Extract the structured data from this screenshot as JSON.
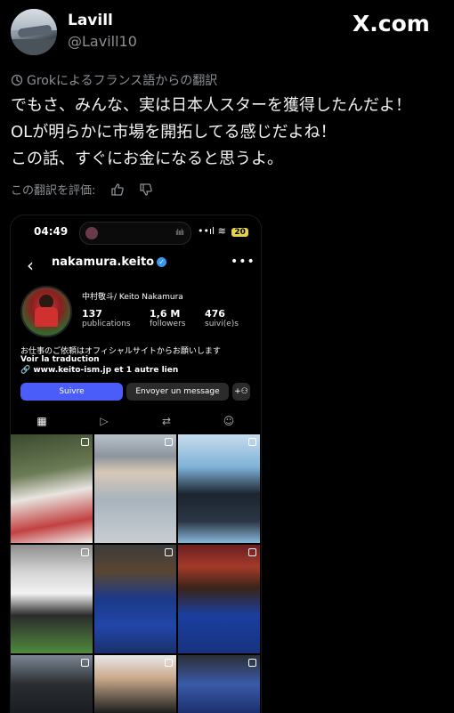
{
  "post": {
    "display_name": "Lavill",
    "handle": "@Lavill10",
    "brand": "X.com",
    "brand_icon": "x-logo",
    "translation_note": "Grokによるフランス語からの翻訳",
    "lines": [
      "でもさ、みんな、実は日本人スターを獲得したんだよ！",
      "OLが明らかに市場を開拓してる感じだよね！",
      "この話、すぐにお金になると思うよ。"
    ],
    "rate_label": "この翻訳を評価:"
  },
  "screenshot": {
    "time": "04:49",
    "signal": "••ıl",
    "battery": "20",
    "username": "nakamura.keito",
    "full_name": "中村敬斗/ Keito Nakamura",
    "stats": [
      {
        "num": "137",
        "label": "publications"
      },
      {
        "num": "1,6 M",
        "label": "followers"
      },
      {
        "num": "476",
        "label": "suivi(e)s"
      }
    ],
    "bio_line": "お仕事のご依頼はオフィシャルサイトからお願いします",
    "see_translation": "Voir la traduction",
    "link": "www.keito-ism.jp et 1 autre lien",
    "follow_button": "Suivre",
    "message_button": "Envoyer un message",
    "tabs": [
      "grid-icon",
      "reels-icon",
      "repost-icon",
      "tagged-icon"
    ],
    "accent_color": "#4a5df9"
  }
}
